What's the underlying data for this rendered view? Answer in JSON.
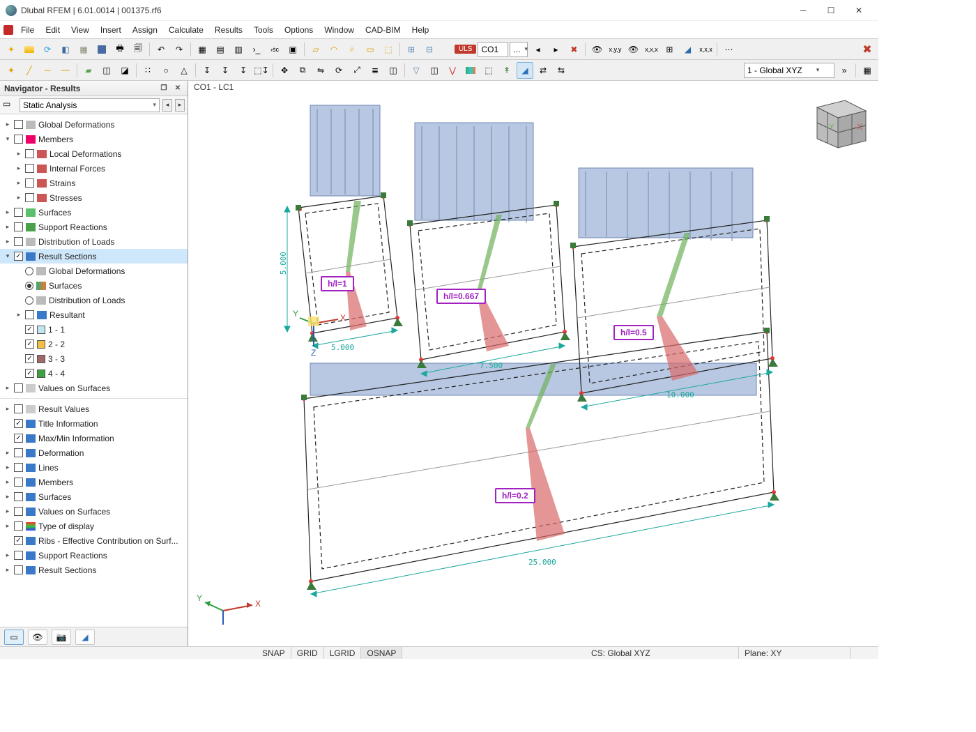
{
  "title": "Dlubal RFEM | 6.01.0014 | 001375.rf6",
  "menu": [
    "File",
    "Edit",
    "View",
    "Insert",
    "Assign",
    "Calculate",
    "Results",
    "Tools",
    "Options",
    "Window",
    "CAD-BIM",
    "Help"
  ],
  "toolbar2_combo": "1 - Global XYZ",
  "load_badge": "ULS",
  "load_case_combo": "CO1",
  "load_case_ell": "...",
  "nav_title": "Navigator - Results",
  "nav_selector": "Static Analysis",
  "tree_a": {
    "gdef": "Global Deformations",
    "members": "Members",
    "mb_local": "Local Deformations",
    "mb_int": "Internal Forces",
    "mb_str": "Strains",
    "mb_sts": "Stresses",
    "surf": "Surfaces",
    "supp": "Support Reactions",
    "dist": "Distribution of Loads",
    "rs": "Result Sections",
    "rs_gdef": "Global Deformations",
    "rs_surf": "Surfaces",
    "rs_dist": "Distribution of Loads",
    "rs_res": "Resultant",
    "rs_1": "1 - 1",
    "rs_2": "2 - 2",
    "rs_3": "3 - 3",
    "rs_4": "4 - 4",
    "vals": "Values on Surfaces"
  },
  "tree_b": {
    "rv": "Result Values",
    "ti": "Title Information",
    "mm": "Max/Min Information",
    "def": "Deformation",
    "lines": "Lines",
    "members": "Members",
    "surf": "Surfaces",
    "vals": "Values on Surfaces",
    "tod": "Type of display",
    "ribs": "Ribs - Effective Contribution on Surf...",
    "supp": "Support Reactions",
    "rs": "Result Sections"
  },
  "viewport": {
    "heading": "CO1 - LC1",
    "tags": {
      "t1": "h/l=1",
      "t2": "h/l=0.667",
      "t3": "h/l=0.5",
      "t4": "h/l=0.2"
    },
    "dims": {
      "h": "5.000",
      "w1": "5.000",
      "w2": "7.500",
      "w3": "10.000",
      "w4": "25.000"
    },
    "axes": {
      "x": "X",
      "y": "Y",
      "z": "Z"
    }
  },
  "status": {
    "snap": "SNAP",
    "grid": "GRID",
    "lgrid": "LGRID",
    "osnap": "OSNAP",
    "cs": "CS: Global XYZ",
    "plane": "Plane: XY"
  }
}
